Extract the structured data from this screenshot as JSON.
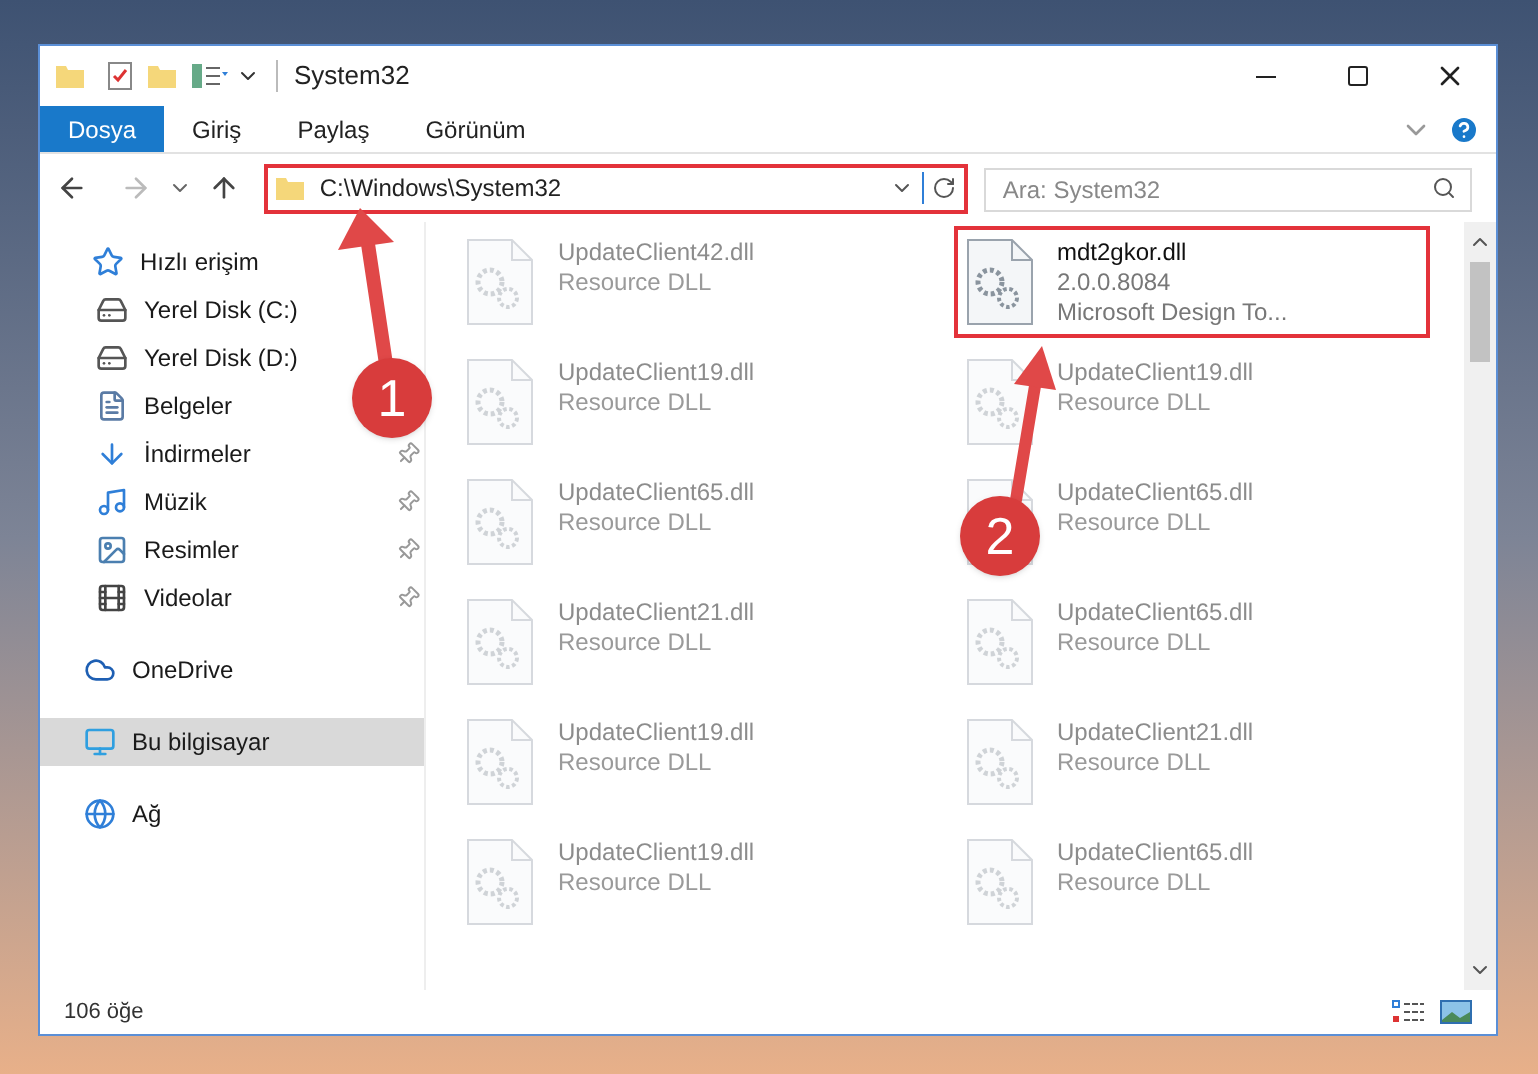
{
  "window": {
    "title": "System32"
  },
  "ribbon_tabs": [
    {
      "label": "Dosya",
      "selected": true
    },
    {
      "label": "Giriş",
      "selected": false
    },
    {
      "label": "Paylaş",
      "selected": false
    },
    {
      "label": "Görünüm",
      "selected": false
    }
  ],
  "address_bar": {
    "path": "C:\\Windows\\System32",
    "highlighted": true
  },
  "search": {
    "placeholder": "Ara: System32"
  },
  "sidebar": {
    "items": [
      {
        "label": "Hızlı erişim",
        "selected": false,
        "children": [
          {
            "label": "Yerel Disk (C:)",
            "pinned": false,
            "selected": false
          },
          {
            "label": "Yerel Disk (D:)",
            "pinned": false,
            "selected": false
          },
          {
            "label": "Belgeler",
            "pinned": false,
            "selected": false
          },
          {
            "label": "İndirmeler",
            "pinned": true,
            "selected": false
          },
          {
            "label": "Müzik",
            "pinned": true,
            "selected": false
          },
          {
            "label": "Resimler",
            "pinned": true,
            "selected": false
          },
          {
            "label": "Videolar",
            "pinned": true,
            "selected": false
          }
        ]
      },
      {
        "label": "OneDrive",
        "selected": false
      },
      {
        "label": "Bu bilgisayar",
        "selected": true
      },
      {
        "label": "Ağ",
        "selected": false
      }
    ]
  },
  "files": [
    {
      "name": "UpdateClient42.dll",
      "type": "Resource DLL",
      "blurred": true,
      "highlighted": false
    },
    {
      "name": "mdt2gkor.dll",
      "version": "2.0.0.8084",
      "type": "Microsoft Design To...",
      "blurred": false,
      "highlighted": true
    },
    {
      "name": "UpdateClient19.dll",
      "type": "Resource DLL",
      "blurred": true,
      "highlighted": false
    },
    {
      "name": "UpdateClient19.dll",
      "type": "Resource DLL",
      "blurred": true,
      "highlighted": false
    },
    {
      "name": "UpdateClient65.dll",
      "type": "Resource DLL",
      "blurred": true,
      "highlighted": false
    },
    {
      "name": "UpdateClient65.dll",
      "type": "Resource DLL",
      "blurred": true,
      "highlighted": false
    },
    {
      "name": "UpdateClient21.dll",
      "type": "Resource DLL",
      "blurred": true,
      "highlighted": false
    },
    {
      "name": "UpdateClient65.dll",
      "type": "Resource DLL",
      "blurred": true,
      "highlighted": false
    },
    {
      "name": "UpdateClient19.dll",
      "type": "Resource DLL",
      "blurred": true,
      "highlighted": false
    },
    {
      "name": "UpdateClient21.dll",
      "type": "Resource DLL",
      "blurred": true,
      "highlighted": false
    },
    {
      "name": "UpdateClient19.dll",
      "type": "Resource DLL",
      "blurred": true,
      "highlighted": false
    },
    {
      "name": "UpdateClient65.dll",
      "type": "Resource DLL",
      "blurred": true,
      "highlighted": false
    }
  ],
  "status_bar": {
    "count": "106 öğe"
  },
  "callouts": [
    {
      "label": "1"
    },
    {
      "label": "2"
    }
  ]
}
